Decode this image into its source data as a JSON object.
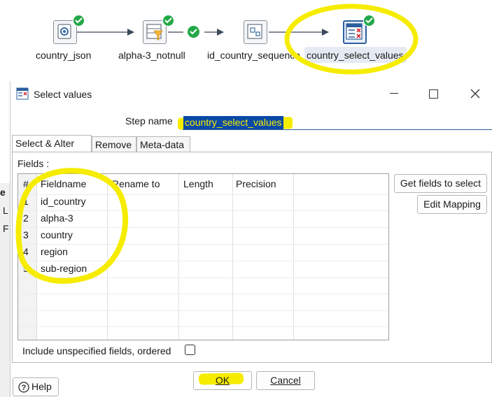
{
  "workflow": {
    "steps": [
      {
        "name": "country_json"
      },
      {
        "name": "alpha-3_notnull"
      },
      {
        "name": "id_country_sequence"
      },
      {
        "name": "country_select_values"
      }
    ]
  },
  "left_panel": {
    "fragments": [
      "e",
      "L",
      "F"
    ]
  },
  "dialog": {
    "title": "Select values",
    "step_name_label": "Step name",
    "step_name_value": "country_select_values",
    "tabs": [
      "Select & Alter",
      "Remove",
      "Meta-data"
    ],
    "fields_label": "Fields :",
    "columns": [
      "#",
      "Fieldname",
      "Rename to",
      "Length",
      "Precision"
    ],
    "rows": [
      {
        "num": "1",
        "fieldname": "id_country"
      },
      {
        "num": "2",
        "fieldname": "alpha-3"
      },
      {
        "num": "3",
        "fieldname": "country"
      },
      {
        "num": "4",
        "fieldname": "region"
      },
      {
        "num": "5",
        "fieldname": "sub-region"
      }
    ],
    "get_fields_button": "Get fields to select",
    "edit_mapping_button": "Edit Mapping",
    "include_unspecified_label": "Include unspecified fields, ordered",
    "include_unspecified_checked": false,
    "help_button": "Help",
    "ok_button": "OK",
    "cancel_button": "Cancel"
  },
  "colors": {
    "annotation_yellow": "#f6ec00",
    "status_green": "#23a847",
    "selection_blue": "#0a4aa6"
  }
}
